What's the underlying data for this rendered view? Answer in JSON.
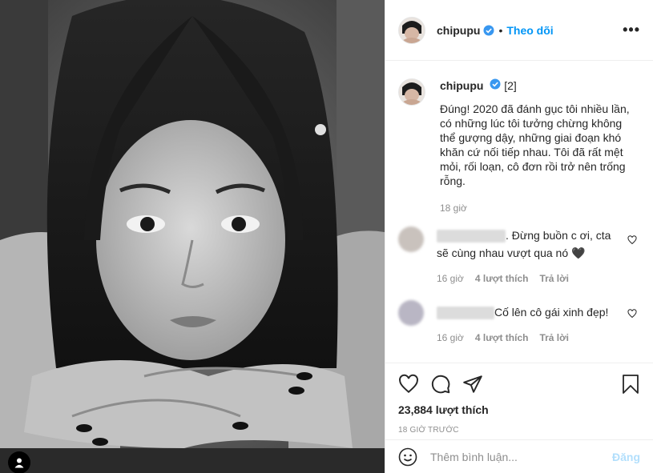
{
  "post": {
    "author": "chipupu",
    "follow_label": "Theo dõi",
    "dot": "•",
    "more_label": "•••"
  },
  "caption": {
    "username": "chipupu",
    "tag": "[2]",
    "text": "Đúng! 2020 đã đánh gục tôi nhiều lần, có những lúc tôi tưởng chừng không thể gượng dậy, những giai đoạn khó khăn cứ nối tiếp nhau. Tôi đã rất mệt mỏi, rối loạn, cô đơn rồi trở nên trống rỗng.",
    "time": "18 giờ"
  },
  "comments": [
    {
      "text": ". Đừng buồn c ơi, cta sẽ cùng nhau vượt qua nó 🖤",
      "time": "16 giờ",
      "likes": "4 lượt thích",
      "reply": "Trả lời"
    },
    {
      "text": "Cố lên cô gái xinh đẹp!",
      "time": "16 giờ",
      "likes": "4 lượt thích",
      "reply": "Trả lời"
    }
  ],
  "actions": {
    "like_icon": "heart-icon",
    "comment_icon": "comment-icon",
    "share_icon": "share-icon",
    "save_icon": "bookmark-icon"
  },
  "likes_count": "23,884 lượt thích",
  "posted_ago": "18 GIỜ TRƯỚC",
  "add_comment": {
    "placeholder": "Thêm bình luận...",
    "post_label": "Đăng"
  },
  "colors": {
    "link_blue": "#0095f6",
    "verified_blue": "#3897f0",
    "muted": "#8e8e8e",
    "post_disabled": "#b2dffc"
  }
}
